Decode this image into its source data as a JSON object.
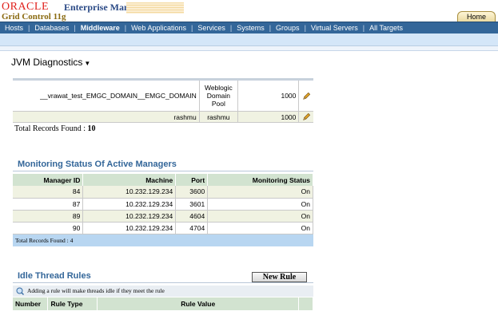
{
  "header": {
    "brand_oracle": "ORACLE",
    "brand_product": "Enterprise Manager",
    "brand_subtitle": "Grid Control 11g",
    "home_tab": "Home"
  },
  "nav": {
    "items": [
      "Hosts",
      "Databases",
      "Middleware",
      "Web Applications",
      "Services",
      "Systems",
      "Groups",
      "Virtual Servers",
      "All Targets"
    ],
    "active": "Middleware"
  },
  "page": {
    "title": "JVM Diagnostics"
  },
  "pool_table": {
    "rows": [
      {
        "name": "__vrawat_test_EMGC_DOMAIN__EMGC_DOMAIN",
        "type": "Weblogic Domain Pool",
        "value": "1000"
      },
      {
        "name": "rashmu",
        "type": "rashmu",
        "value": "1000"
      }
    ],
    "total_label": "Total Records Found :",
    "total_count": "10"
  },
  "managers": {
    "title": "Monitoring Status Of Active Managers",
    "columns": [
      "Manager ID",
      "Machine",
      "Port",
      "Monitoring Status"
    ],
    "rows": [
      [
        "84",
        "10.232.129.234",
        "3600",
        "On"
      ],
      [
        "87",
        "10.232.129.234",
        "3601",
        "On"
      ],
      [
        "89",
        "10.232.129.234",
        "4604",
        "On"
      ],
      [
        "90",
        "10.232.129.234",
        "4704",
        "On"
      ]
    ],
    "footer": "Total Records Found : 4"
  },
  "idle_rules": {
    "title": "Idle Thread Rules",
    "new_rule_button": "New Rule",
    "tip": "Adding a rule will make threads idle if they meet the rule",
    "columns": [
      "Number",
      "Rule Type",
      "Rule Value"
    ]
  },
  "colors": {
    "nav_bg": "#336699",
    "section_title": "#336699",
    "oracle_red": "#e0201c"
  }
}
